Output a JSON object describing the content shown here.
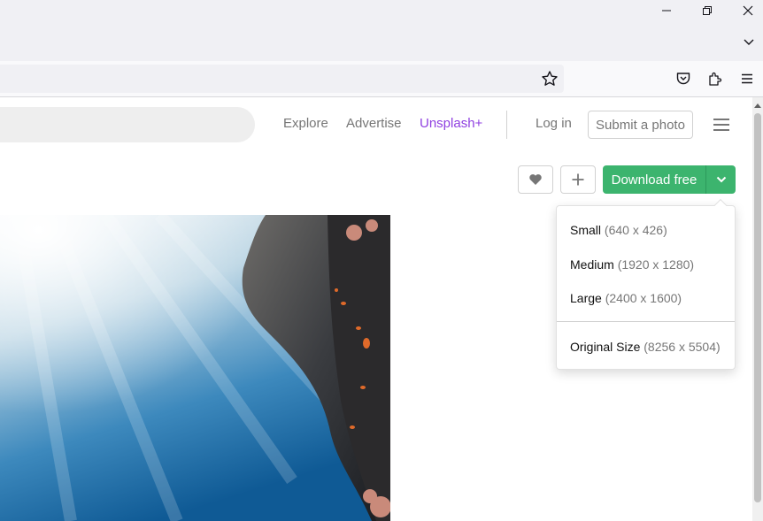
{
  "browser": {
    "controls": {
      "minimize": "minimize-icon",
      "restore": "restore-icon",
      "close": "close-icon"
    },
    "toolbar_icons": [
      "pocket-icon",
      "extensions-icon",
      "menu-icon"
    ]
  },
  "header": {
    "nav": {
      "explore": "Explore",
      "advertise": "Advertise",
      "unsplash_plus": "Unsplash+"
    },
    "login": "Log in",
    "submit_photo": "Submit a photo"
  },
  "actions": {
    "download_free": "Download free"
  },
  "download_menu": {
    "items": [
      {
        "label": "Small",
        "size": "(640 x 426)"
      },
      {
        "label": "Medium",
        "size": "(1920 x 1280)"
      },
      {
        "label": "Large",
        "size": "(2400 x 1600)"
      },
      {
        "label": "Original Size",
        "size": "(8256 x 5504)"
      }
    ]
  },
  "colors": {
    "accent_green": "#3cb46e",
    "plus_purple": "#8f3fe0",
    "text_gray": "#767676"
  }
}
